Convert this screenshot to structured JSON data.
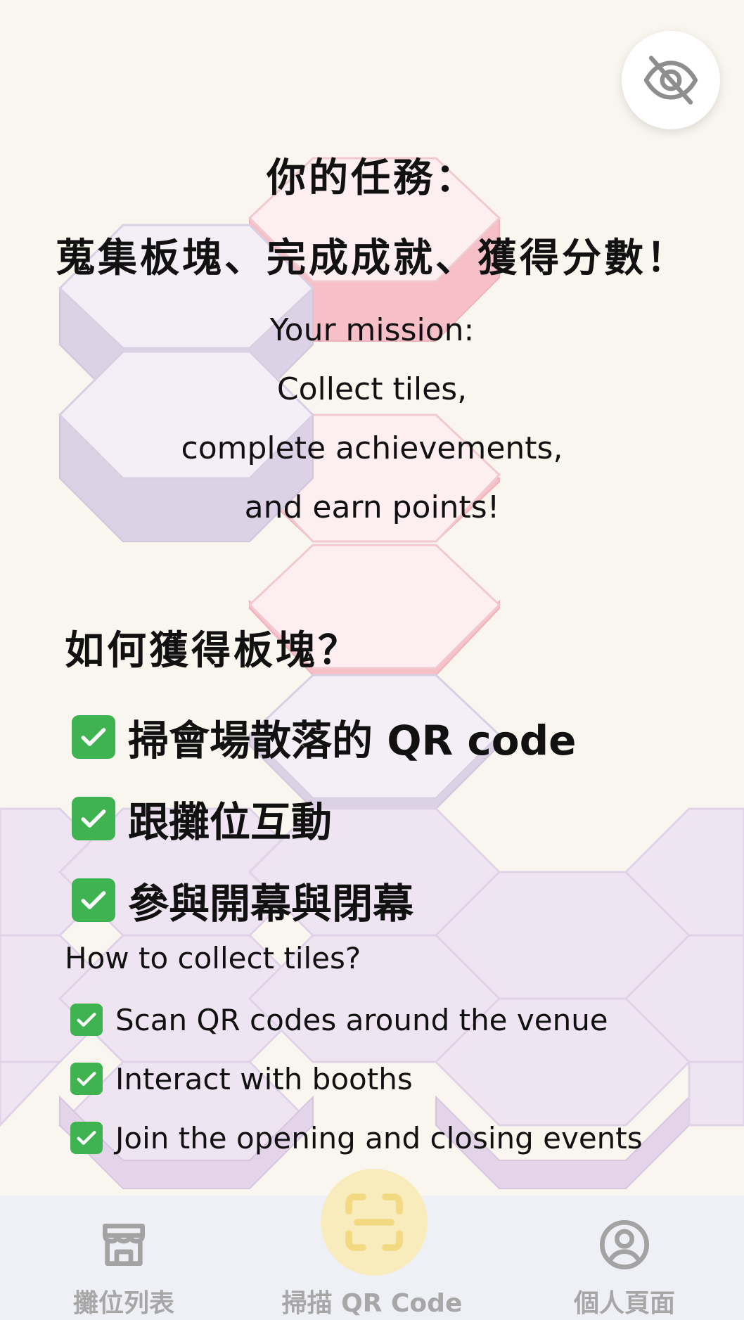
{
  "mission": {
    "title_zh": "你的任務：",
    "subtitle_zh": "蒐集板塊、完成成就、獲得分數！",
    "en_lines": [
      "Your mission:",
      "Collect tiles,",
      "complete achievements,",
      "and earn points!"
    ]
  },
  "how_zh": {
    "heading": "如何獲得板塊？",
    "items": [
      "掃會場散落的 QR code",
      "跟攤位互動",
      "參與開幕與閉幕"
    ]
  },
  "how_en": {
    "heading": "How to collect tiles?",
    "items": [
      "Scan QR codes around the venue",
      "Interact with booths",
      "Join the opening and closing events"
    ]
  },
  "nav": {
    "booths": "攤位列表",
    "scan": "掃描 QR Code",
    "profile": "個人頁面"
  },
  "icons": {
    "visibility": "eye-off-icon",
    "check": "check-mark-icon",
    "booth": "storefront-icon",
    "scan": "qr-scan-icon",
    "profile": "user-circle-icon"
  },
  "colors": {
    "background": "#f9f6ef",
    "check_green": "#3fb350",
    "nav_background": "#eef0f6",
    "scan_highlight": "#f8ecbc",
    "tile_pink": "#f7bfc8",
    "tile_lavender": "#ddd1e6"
  }
}
